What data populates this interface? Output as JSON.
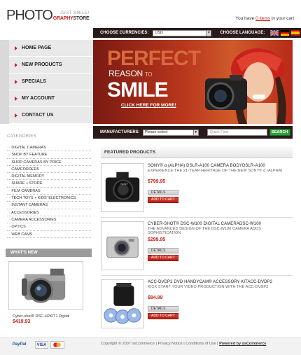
{
  "logo": {
    "photo": "PHOTO",
    "tagline": "JUST SMILE!",
    "sub_red": "GRAPHY",
    "sub_dark": "STORE"
  },
  "cart": {
    "prefix": "You have",
    "count": "0 items",
    "suffix": "in your cart"
  },
  "topbar": {
    "currencies_label": "CHOOSE CURRENCIES:",
    "currency_value": "USD",
    "language_label": "CHOOSE LANGUAGE:",
    "flags": [
      "uk-flag",
      "germany-flag",
      "spain-flag"
    ]
  },
  "nav": [
    "HOME PAGE",
    "NEW PRODUCTS",
    "SPECIALS",
    "MY ACCOUNT",
    "CONTACT US"
  ],
  "banner": {
    "perfect": "PERFECT",
    "reason": "REASON",
    "to": "TO",
    "smile": "SMILE",
    "cta": "CLICK HERE FOR MORE!"
  },
  "manufacturers": {
    "label": "MANUFACTURERS:",
    "select_value": "Please select",
    "search_placeholder": "Quick Find",
    "search_button": "SEARCH"
  },
  "categories": {
    "heading": "CATEGORIES",
    "items": [
      "DIGITAL CAMERAS",
      "SHOP BY FEATURE",
      "SHOP CAMERAS BY PRICE",
      "CAMCORDERS",
      "DIGITAL MEMORY",
      "SHARE + STORE",
      "FILM CAMERAS",
      "TECH TOYS + KIDS' ELECTRONICS",
      "INSTANT CAMERAS",
      "ACCESSORIES",
      "CAMERA ACCESSORIES",
      "OPTICS",
      "WEB CAMS"
    ]
  },
  "whats_new": {
    "heading": "WHAT'S NEW",
    "name": "Cyber-shot® DSC-H2KIT1 Digital",
    "price": "$419.93"
  },
  "featured": {
    "heading": "FEATURED PRODUCTS",
    "details_label": "DETAILS",
    "cart_label": "ADD TO CART",
    "products": [
      {
        "title": "SONY® α (ALPHA) DSLR-A100 CAMERA BODYDSLR-A100",
        "desc": "EXPERIENCE THE 21-YEAR HERITAGE OF THE NEW SONY® α (ALPHA)",
        "price": "$799.95"
      },
      {
        "title": "CYBER-SHOT® DSC-W100 DIGITAL CAMERADSC-W100",
        "desc": "THE ADVANCED DESIGN OF THE DSC-W100 CAMERA ADDS SOPHISTICATION",
        "price": "$299.95"
      },
      {
        "title": "ACC-DVDP2 DVD HANDYCAM® ACCESSORY KITACC-DVDP2",
        "desc": "KICK START YOUR VIDEO PRODUCTION WITH THE ACC-DVDP2",
        "price": "$84.99"
      }
    ]
  },
  "footer": {
    "paypal": "PayPal",
    "visa": "VISA",
    "copyright": "Copyright © 2007 osCommerce | Privacy Notice | Conditions of Use |",
    "powered": "Powered by osCommerce"
  },
  "colors": {
    "accent": "#c8221b",
    "dark_bar": "#2a1b1a",
    "search_green": "#2fa03a"
  }
}
